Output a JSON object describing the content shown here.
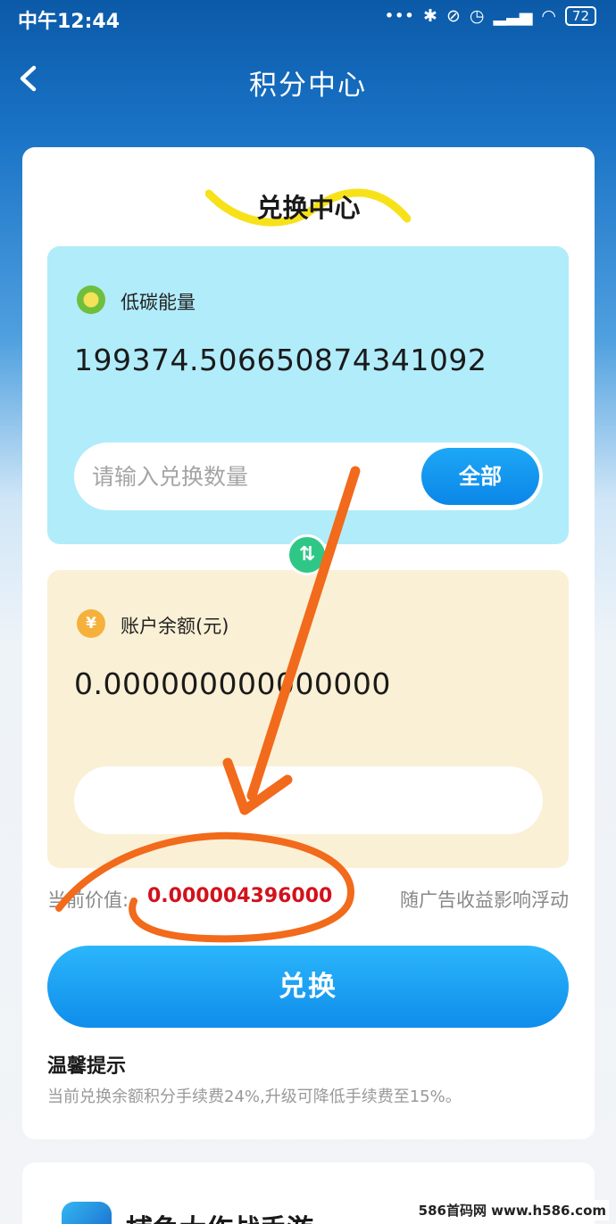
{
  "status_bar": {
    "time": "中午12:44",
    "icons": [
      "dots-icon",
      "bluetooth-icon",
      "mute-icon",
      "alarm-icon",
      "signal-icon",
      "wifi-icon"
    ],
    "battery": "72"
  },
  "nav": {
    "back_glyph": "<",
    "title": "积分中心"
  },
  "exchange_card": {
    "title": "兑换中心",
    "source": {
      "label": "低碳能量",
      "value": "199374.506650874341092",
      "input_placeholder": "请输入兑换数量",
      "all_button": "全部"
    },
    "swap_glyph": "⇅",
    "target": {
      "label": "账户余额(元)",
      "value": "0.000000000000000",
      "yuan_glyph": "¥"
    },
    "current_value_label": "当前价值:",
    "current_value": "0.000004396000",
    "float_note": "随广告收益影响浮动",
    "exchange_button": "兑换",
    "tips_title": "温馨提示",
    "tips_text": "当前兑换余额积分手续费24%,升级可降低手续费至15%。"
  },
  "game_card": {
    "title": "捕鱼大作战手游"
  },
  "watermark": "586首码网 www.h586.com",
  "colors": {
    "accent_blue": "#0f8deb",
    "swap_green": "#2fc786",
    "value_red": "#d2121c",
    "annotation_orange": "#f26a1b",
    "highlight_yellow": "#f7e21a"
  }
}
